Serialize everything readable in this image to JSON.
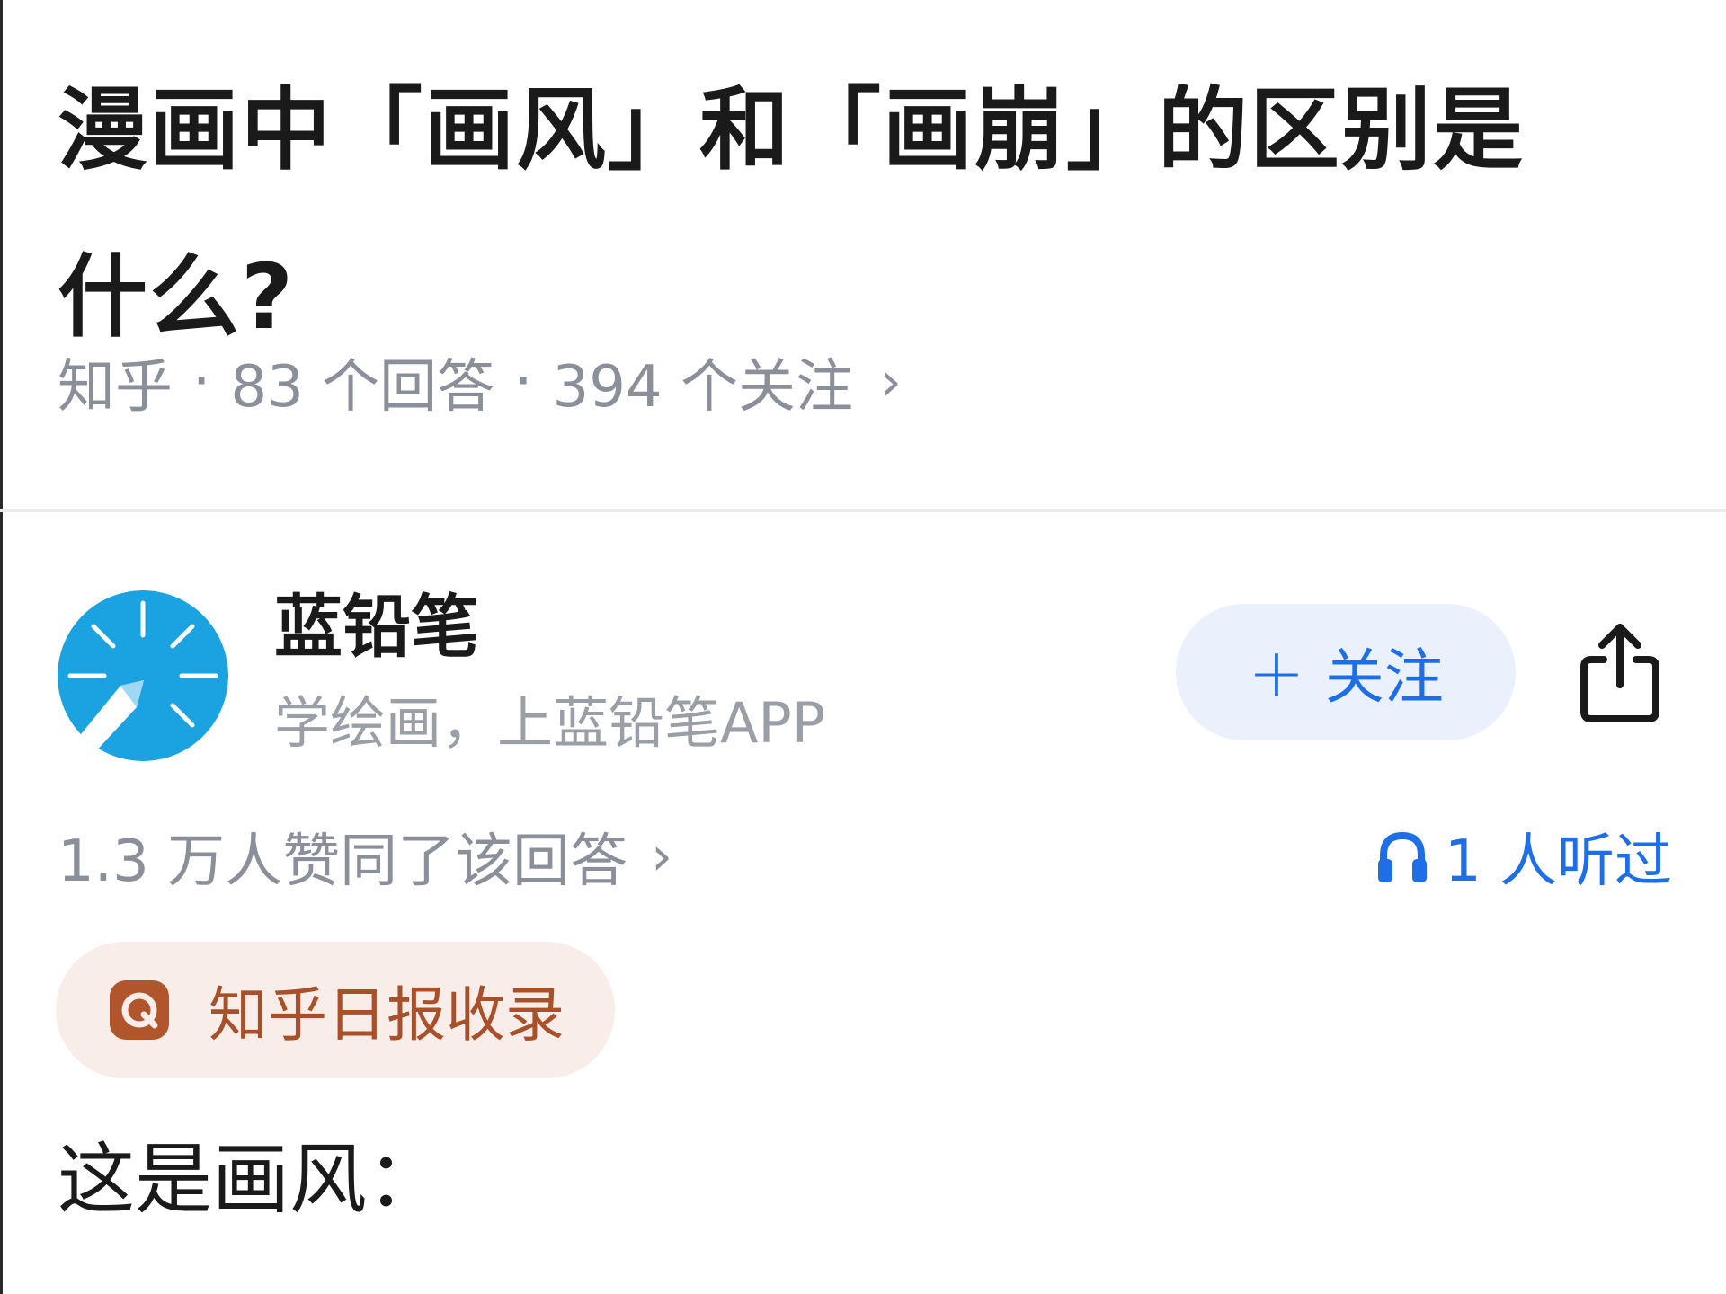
{
  "question": {
    "title": "漫画中「画风」和「画崩」的区别是什么?"
  },
  "meta": {
    "source": "知乎",
    "separator": "·",
    "answers": "83 个回答",
    "followers": "394 个关注",
    "chevron": "›"
  },
  "author": {
    "name": "蓝铅笔",
    "bio": "学绘画，上蓝铅笔APP",
    "avatar_color": "#1aa3e0"
  },
  "follow_button": {
    "plus": "+",
    "label": "关注"
  },
  "share": {
    "icon": "share-icon"
  },
  "stats": {
    "upvotes": "1.3 万人赞同了该回答",
    "chevron": "›",
    "listeners": "1 人听过"
  },
  "badge": {
    "label": "知乎日报收录",
    "color": "#a8502a"
  },
  "answer": {
    "first_line": "这是画风："
  },
  "colors": {
    "accent_blue": "#1e6fe6",
    "muted_gray": "#8a8f99"
  }
}
